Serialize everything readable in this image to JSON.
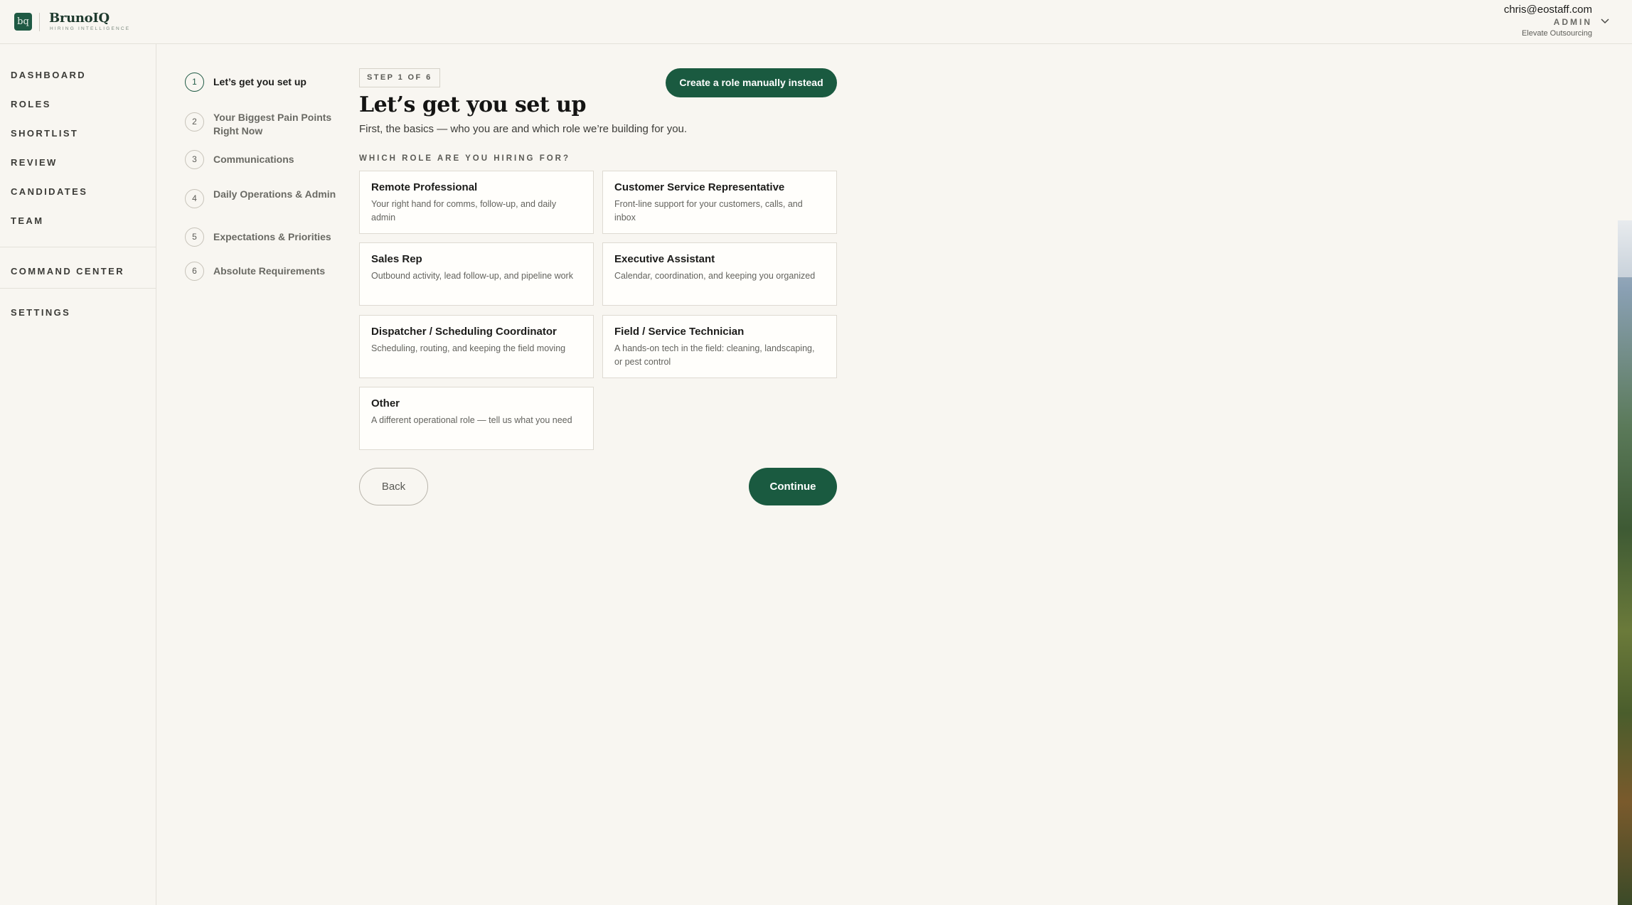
{
  "brand": {
    "logo_mark": "bq",
    "name": "BrunoIQ",
    "tagline": "HIRING INTELLIGENCE"
  },
  "user": {
    "email": "chris@eostaff.com",
    "role": "ADMIN",
    "org": "Elevate Outsourcing",
    "menu_icon": "chevron-down-icon"
  },
  "sidebar": {
    "items": [
      {
        "label": "DASHBOARD"
      },
      {
        "label": "ROLES"
      },
      {
        "label": "SHORTLIST"
      },
      {
        "label": "REVIEW"
      },
      {
        "label": "CANDIDATES"
      },
      {
        "label": "TEAM"
      },
      {
        "label": "COMMAND CENTER"
      },
      {
        "label": "SETTINGS"
      }
    ]
  },
  "steps": [
    {
      "num": "1",
      "label": "Let’s get you set up",
      "active": true
    },
    {
      "num": "2",
      "label": "Your Biggest Pain Points Right Now"
    },
    {
      "num": "3",
      "label": "Communications"
    },
    {
      "num": "4",
      "label": "Daily Operations & Admin"
    },
    {
      "num": "5",
      "label": "Expectations & Priorities"
    },
    {
      "num": "6",
      "label": "Absolute Requirements"
    }
  ],
  "main": {
    "step_badge": "STEP 1 OF 6",
    "manual_button": "Create a role manually instead",
    "title": "Let’s get you set up",
    "subtitle": "First, the basics — who you are and which role we’re building for you.",
    "question": "WHICH ROLE ARE YOU HIRING FOR?",
    "roles": [
      {
        "title": "Remote Professional",
        "desc": "Your right hand for comms, follow-up, and daily admin"
      },
      {
        "title": "Customer Service Representative",
        "desc": "Front-line support for your customers, calls, and inbox"
      },
      {
        "title": "Sales Rep",
        "desc": "Outbound activity, lead follow-up, and pipeline work"
      },
      {
        "title": "Executive Assistant",
        "desc": "Calendar, coordination, and keeping you organized"
      },
      {
        "title": "Dispatcher / Scheduling Coordinator",
        "desc": "Scheduling, routing, and keeping the field moving"
      },
      {
        "title": "Field / Service Technician",
        "desc": "A hands-on tech in the field: cleaning, landscaping, or pest control"
      },
      {
        "title": "Other",
        "desc": "A different operational role — tell us what you need"
      }
    ],
    "back_button": "Back",
    "continue_button": "Continue"
  },
  "colors": {
    "accent": "#1a5a40",
    "background": "#f8f6f1"
  }
}
